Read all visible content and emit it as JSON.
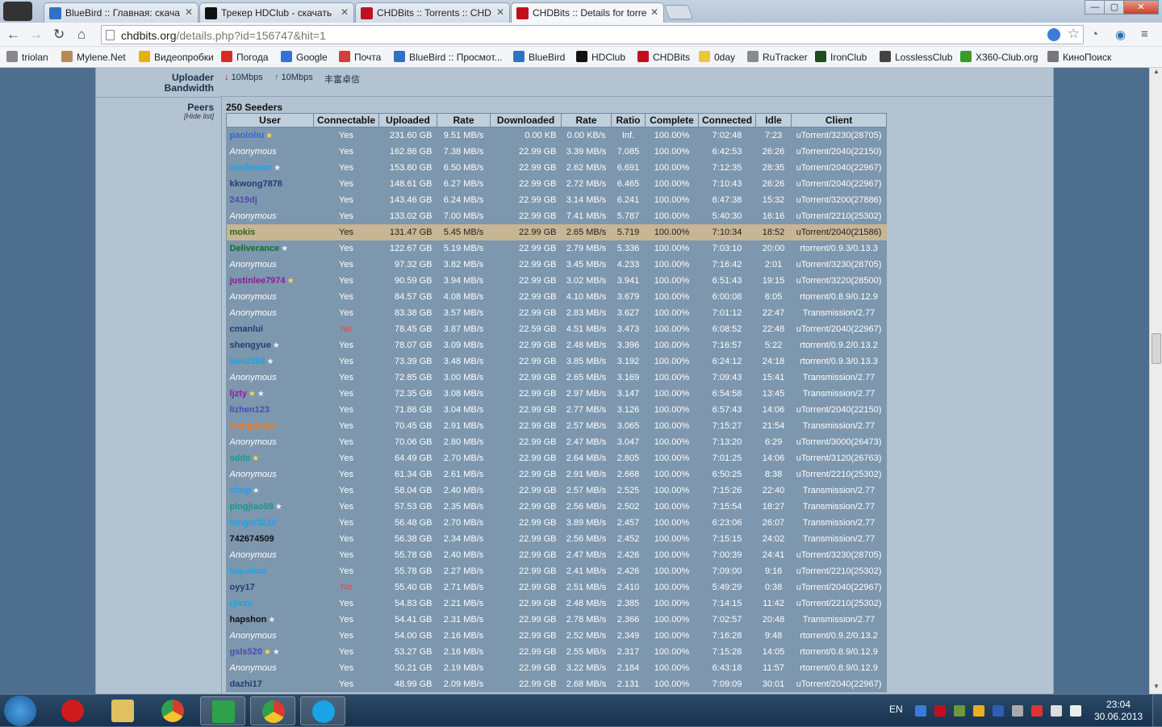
{
  "tabs": [
    {
      "title": "BlueBird :: Главная: скача",
      "color": "#2e72c8"
    },
    {
      "title": "Трекер HDClub - скачать",
      "color": "#111111"
    },
    {
      "title": "CHDBits :: Torrents :: CHD",
      "color": "#c0101e"
    },
    {
      "title": "CHDBits :: Details for torre",
      "color": "#c0101e"
    }
  ],
  "window": {
    "minimize": "—",
    "maximize": "▢",
    "close": "✕"
  },
  "address": {
    "host": "chdbits.org",
    "path": "/details.php?id=156747&hit=1"
  },
  "bookmarks": [
    {
      "label": "triolan",
      "color": "#888888"
    },
    {
      "label": "Mylene.Net",
      "color": "#b58a5a"
    },
    {
      "label": "Видеопробки",
      "color": "#e2b400"
    },
    {
      "label": "Погода",
      "color": "#d62b2b"
    },
    {
      "label": "Google",
      "color": "#3b6fd8"
    },
    {
      "label": "Почта",
      "color": "#d63c3c"
    },
    {
      "label": "BlueBird :: Просмот...",
      "color": "#2e72c8"
    },
    {
      "label": "BlueBird",
      "color": "#2e72c8"
    },
    {
      "label": "HDClub",
      "color": "#111111"
    },
    {
      "label": "CHDBits",
      "color": "#c0101e"
    },
    {
      "label": "0day",
      "color": "#e8c93b"
    },
    {
      "label": "RuTracker",
      "color": "#8a8a8a"
    },
    {
      "label": "IronClub",
      "color": "#1f4d1f"
    },
    {
      "label": "LosslessClub",
      "color": "#444444"
    },
    {
      "label": "X360-Club.org",
      "color": "#3a9a2a"
    },
    {
      "label": "КиноПоиск",
      "color": "#777777"
    }
  ],
  "bandwidth": {
    "label_line1": "Uploader",
    "label_line2": "Bandwidth",
    "down": "10Mbps",
    "up": "10Mbps",
    "tail": "丰富卓信"
  },
  "peers": {
    "label": "Peers",
    "hide_link": "[Hide list]",
    "count_title": "250 Seeders"
  },
  "columns": [
    "User",
    "Connectable",
    "Uploaded",
    "Rate",
    "Downloaded",
    "Rate",
    "Ratio",
    "Complete",
    "Connected",
    "Idle",
    "Client"
  ],
  "rows": [
    {
      "user": "paolohu",
      "color": "#3b63d6",
      "badge": "star",
      "conn": "Yes",
      "up": "231.60 GB",
      "urate": "9.51 MB/s",
      "down": "0.00 KB",
      "drate": "0.00 KB/s",
      "ratio": "Inf.",
      "comp": "100.00%",
      "connected": "7:02:48",
      "idle": "7:23",
      "client": "uTorrent/3230(28705)"
    },
    {
      "user": "Anonymous",
      "anon": true,
      "conn": "Yes",
      "up": "162.86 GB",
      "urate": "7.38 MB/s",
      "down": "22.99 GB",
      "drate": "3.39 MB/s",
      "ratio": "7.085",
      "comp": "100.00%",
      "connected": "6:42:53",
      "idle": "26:26",
      "client": "uTorrent/2040(22150)"
    },
    {
      "user": "confessor",
      "color": "#19a3ec",
      "badge": "wstar",
      "conn": "Yes",
      "up": "153.80 GB",
      "urate": "6.50 MB/s",
      "down": "22.99 GB",
      "drate": "2.62 MB/s",
      "ratio": "6.691",
      "comp": "100.00%",
      "connected": "7:12:35",
      "idle": "28:35",
      "client": "uTorrent/2040(22967)"
    },
    {
      "user": "kkwong7878",
      "color": "#243d74",
      "conn": "Yes",
      "up": "148.61 GB",
      "urate": "6.27 MB/s",
      "down": "22.99 GB",
      "drate": "2.72 MB/s",
      "ratio": "6.465",
      "comp": "100.00%",
      "connected": "7:10:43",
      "idle": "26:26",
      "client": "uTorrent/2040(22967)"
    },
    {
      "user": "2419dj",
      "color": "#4b4bb0",
      "conn": "Yes",
      "up": "143.46 GB",
      "urate": "6.24 MB/s",
      "down": "22.99 GB",
      "drate": "3.14 MB/s",
      "ratio": "6.241",
      "comp": "100.00%",
      "connected": "6:47:38",
      "idle": "15:32",
      "client": "uTorrent/3200(27886)"
    },
    {
      "user": "Anonymous",
      "anon": true,
      "conn": "Yes",
      "up": "133.02 GB",
      "urate": "7.00 MB/s",
      "down": "22.99 GB",
      "drate": "7.41 MB/s",
      "ratio": "5.787",
      "comp": "100.00%",
      "connected": "5:40:30",
      "idle": "16:16",
      "client": "uTorrent/2210(25302)"
    },
    {
      "user": "mokis",
      "color": "#2b6a16",
      "highlight": true,
      "conn": "Yes",
      "up": "131.47 GB",
      "urate": "5.45 MB/s",
      "down": "22.99 GB",
      "drate": "2.65 MB/s",
      "ratio": "5.719",
      "comp": "100.00%",
      "connected": "7:10:34",
      "idle": "18:52",
      "client": "uTorrent/2040(21586)"
    },
    {
      "user": "Deliverance",
      "color": "#0f6f28",
      "badge": "wstar",
      "conn": "Yes",
      "up": "122.67 GB",
      "urate": "5.19 MB/s",
      "down": "22.99 GB",
      "drate": "2.79 MB/s",
      "ratio": "5.336",
      "comp": "100.00%",
      "connected": "7:03:10",
      "idle": "20:00",
      "client": "rtorrent/0.9.3/0.13.3"
    },
    {
      "user": "Anonymous",
      "anon": true,
      "conn": "Yes",
      "up": "97.32 GB",
      "urate": "3.82 MB/s",
      "down": "22.99 GB",
      "drate": "3.45 MB/s",
      "ratio": "4.233",
      "comp": "100.00%",
      "connected": "7:16:42",
      "idle": "2:01",
      "client": "uTorrent/3230(28705)"
    },
    {
      "user": "justinlee7974",
      "color": "#8f1aa0",
      "badge": "star",
      "conn": "Yes",
      "up": "90.59 GB",
      "urate": "3.94 MB/s",
      "down": "22.99 GB",
      "drate": "3.02 MB/s",
      "ratio": "3.941",
      "comp": "100.00%",
      "connected": "6:51:43",
      "idle": "19:15",
      "client": "uTorrent/3220(28500)"
    },
    {
      "user": "Anonymous",
      "anon": true,
      "conn": "Yes",
      "up": "84.57 GB",
      "urate": "4.08 MB/s",
      "down": "22.99 GB",
      "drate": "4.10 MB/s",
      "ratio": "3.679",
      "comp": "100.00%",
      "connected": "6:00:08",
      "idle": "6:05",
      "client": "rtorrent/0.8.9/0.12.9"
    },
    {
      "user": "Anonymous",
      "anon": true,
      "conn": "Yes",
      "up": "83.38 GB",
      "urate": "3.57 MB/s",
      "down": "22.99 GB",
      "drate": "2.83 MB/s",
      "ratio": "3.627",
      "comp": "100.00%",
      "connected": "7:01:12",
      "idle": "22:47",
      "client": "Transmission/2.77"
    },
    {
      "user": "cmanlui",
      "color": "#243d74",
      "conn": "No",
      "up": "78.45 GB",
      "urate": "3.87 MB/s",
      "down": "22.59 GB",
      "drate": "4.51 MB/s",
      "ratio": "3.473",
      "comp": "100.00%",
      "connected": "6:08:52",
      "idle": "22:48",
      "client": "uTorrent/2040(22967)"
    },
    {
      "user": "shengyue",
      "color": "#243d74",
      "badge": "wstar",
      "conn": "Yes",
      "up": "78.07 GB",
      "urate": "3.09 MB/s",
      "down": "22.99 GB",
      "drate": "2.48 MB/s",
      "ratio": "3.396",
      "comp": "100.00%",
      "connected": "7:16:57",
      "idle": "5:22",
      "client": "rtorrent/0.9.2/0.13.2"
    },
    {
      "user": "lion2262",
      "color": "#19a3ec",
      "badge": "wstar",
      "conn": "Yes",
      "up": "73.39 GB",
      "urate": "3.48 MB/s",
      "down": "22.99 GB",
      "drate": "3.85 MB/s",
      "ratio": "3.192",
      "comp": "100.00%",
      "connected": "6:24:12",
      "idle": "24:18",
      "client": "rtorrent/0.9.3/0.13.3"
    },
    {
      "user": "Anonymous",
      "anon": true,
      "conn": "Yes",
      "up": "72.85 GB",
      "urate": "3.00 MB/s",
      "down": "22.99 GB",
      "drate": "2.65 MB/s",
      "ratio": "3.169",
      "comp": "100.00%",
      "connected": "7:09:43",
      "idle": "15:41",
      "client": "Transmission/2.77"
    },
    {
      "user": "ljzty",
      "color": "#8f1aa0",
      "badge": "starwstar",
      "conn": "Yes",
      "up": "72.35 GB",
      "urate": "3.08 MB/s",
      "down": "22.99 GB",
      "drate": "2.97 MB/s",
      "ratio": "3.147",
      "comp": "100.00%",
      "connected": "6:54:58",
      "idle": "13:45",
      "client": "Transmission/2.77"
    },
    {
      "user": "lizhen123",
      "color": "#4b4bb0",
      "conn": "Yes",
      "up": "71.86 GB",
      "urate": "3.04 MB/s",
      "down": "22.99 GB",
      "drate": "2.77 MB/s",
      "ratio": "3.126",
      "comp": "100.00%",
      "connected": "6:57:43",
      "idle": "14:06",
      "client": "uTorrent/2040(22150)"
    },
    {
      "user": "wangpeiyu",
      "color": "#f07a1a",
      "conn": "Yes",
      "up": "70.45 GB",
      "urate": "2.91 MB/s",
      "down": "22.99 GB",
      "drate": "2.57 MB/s",
      "ratio": "3.065",
      "comp": "100.00%",
      "connected": "7:15:27",
      "idle": "21:54",
      "client": "Transmission/2.77"
    },
    {
      "user": "Anonymous",
      "anon": true,
      "conn": "Yes",
      "up": "70.06 GB",
      "urate": "2.80 MB/s",
      "down": "22.99 GB",
      "drate": "2.47 MB/s",
      "ratio": "3.047",
      "comp": "100.00%",
      "connected": "7:13:20",
      "idle": "6:29",
      "client": "uTorrent/3000(26473)"
    },
    {
      "user": "sdds",
      "color": "#159a8a",
      "badge": "star",
      "conn": "Yes",
      "up": "64.49 GB",
      "urate": "2.70 MB/s",
      "down": "22.99 GB",
      "drate": "2.64 MB/s",
      "ratio": "2.805",
      "comp": "100.00%",
      "connected": "7:01:25",
      "idle": "14:06",
      "client": "uTorrent/3120(26763)"
    },
    {
      "user": "Anonymous",
      "anon": true,
      "conn": "Yes",
      "up": "61.34 GB",
      "urate": "2.61 MB/s",
      "down": "22.99 GB",
      "drate": "2.91 MB/s",
      "ratio": "2.668",
      "comp": "100.00%",
      "connected": "6:50:25",
      "idle": "8:38",
      "client": "uTorrent/2210(25302)"
    },
    {
      "user": "chnp",
      "color": "#19a3ec",
      "badge": "wstar",
      "conn": "Yes",
      "up": "58.04 GB",
      "urate": "2.40 MB/s",
      "down": "22.99 GB",
      "drate": "2.57 MB/s",
      "ratio": "2.525",
      "comp": "100.00%",
      "connected": "7:15:26",
      "idle": "22:40",
      "client": "Transmission/2.77"
    },
    {
      "user": "pingjiao99",
      "color": "#159a8a",
      "badge": "wstar",
      "conn": "Yes",
      "up": "57.53 GB",
      "urate": "2.35 MB/s",
      "down": "22.99 GB",
      "drate": "2.56 MB/s",
      "ratio": "2.502",
      "comp": "100.00%",
      "connected": "7:15:54",
      "idle": "18:27",
      "client": "Transmission/2.77"
    },
    {
      "user": "longer3210",
      "color": "#19a3ec",
      "conn": "Yes",
      "up": "56.48 GB",
      "urate": "2.70 MB/s",
      "down": "22.99 GB",
      "drate": "3.89 MB/s",
      "ratio": "2.457",
      "comp": "100.00%",
      "connected": "6:23:06",
      "idle": "26:07",
      "client": "Transmission/2.77"
    },
    {
      "user": "742674509",
      "color": "#111111",
      "conn": "Yes",
      "up": "56.38 GB",
      "urate": "2.34 MB/s",
      "down": "22.99 GB",
      "drate": "2.56 MB/s",
      "ratio": "2.452",
      "comp": "100.00%",
      "connected": "7:15:15",
      "idle": "24:02",
      "client": "Transmission/2.77"
    },
    {
      "user": "Anonymous",
      "anon": true,
      "conn": "Yes",
      "up": "55.78 GB",
      "urate": "2.40 MB/s",
      "down": "22.99 GB",
      "drate": "2.47 MB/s",
      "ratio": "2.426",
      "comp": "100.00%",
      "connected": "7:00:39",
      "idle": "24:41",
      "client": "uTorrent/3230(28705)"
    },
    {
      "user": "liujunhui",
      "color": "#19a3ec",
      "conn": "Yes",
      "up": "55.78 GB",
      "urate": "2.27 MB/s",
      "down": "22.99 GB",
      "drate": "2.41 MB/s",
      "ratio": "2.426",
      "comp": "100.00%",
      "connected": "7:09:00",
      "idle": "9:16",
      "client": "uTorrent/2210(25302)"
    },
    {
      "user": "oyy17",
      "color": "#243d74",
      "conn": "No",
      "up": "55.40 GB",
      "urate": "2.71 MB/s",
      "down": "22.99 GB",
      "drate": "2.51 MB/s",
      "ratio": "2.410",
      "comp": "100.00%",
      "connected": "5:49:29",
      "idle": "0:38",
      "client": "uTorrent/2040(22967)"
    },
    {
      "user": "rjlxzy",
      "color": "#19a3ec",
      "conn": "Yes",
      "up": "54.83 GB",
      "urate": "2.21 MB/s",
      "down": "22.99 GB",
      "drate": "2.48 MB/s",
      "ratio": "2.385",
      "comp": "100.00%",
      "connected": "7:14:15",
      "idle": "11:42",
      "client": "uTorrent/2210(25302)"
    },
    {
      "user": "hapshon",
      "color": "#111111",
      "badge": "wstar",
      "conn": "Yes",
      "up": "54.41 GB",
      "urate": "2.31 MB/s",
      "down": "22.99 GB",
      "drate": "2.78 MB/s",
      "ratio": "2.366",
      "comp": "100.00%",
      "connected": "7:02:57",
      "idle": "20:48",
      "client": "Transmission/2.77"
    },
    {
      "user": "Anonymous",
      "anon": true,
      "conn": "Yes",
      "up": "54.00 GB",
      "urate": "2.16 MB/s",
      "down": "22.99 GB",
      "drate": "2.52 MB/s",
      "ratio": "2.349",
      "comp": "100.00%",
      "connected": "7:16:28",
      "idle": "9:48",
      "client": "rtorrent/0.9.2/0.13.2"
    },
    {
      "user": "gsls520",
      "color": "#4b4bb0",
      "badge": "starwstar",
      "conn": "Yes",
      "up": "53.27 GB",
      "urate": "2.16 MB/s",
      "down": "22.99 GB",
      "drate": "2.55 MB/s",
      "ratio": "2.317",
      "comp": "100.00%",
      "connected": "7:15:28",
      "idle": "14:05",
      "client": "rtorrent/0.8.9/0.12.9"
    },
    {
      "user": "Anonymous",
      "anon": true,
      "conn": "Yes",
      "up": "50.21 GB",
      "urate": "2.19 MB/s",
      "down": "22.99 GB",
      "drate": "3.22 MB/s",
      "ratio": "2.184",
      "comp": "100.00%",
      "connected": "6:43:18",
      "idle": "11:57",
      "client": "rtorrent/0.8.9/0.12.9"
    },
    {
      "user": "dazhi17",
      "color": "#243d74",
      "conn": "Yes",
      "up": "48.99 GB",
      "urate": "2.09 MB/s",
      "down": "22.99 GB",
      "drate": "2.68 MB/s",
      "ratio": "2.131",
      "comp": "100.00%",
      "connected": "7:09:09",
      "idle": "30:01",
      "client": "uTorrent/2040(22967)"
    }
  ],
  "taskbar": {
    "lang": "EN",
    "time": "23:04",
    "date": "30.06.2013"
  }
}
